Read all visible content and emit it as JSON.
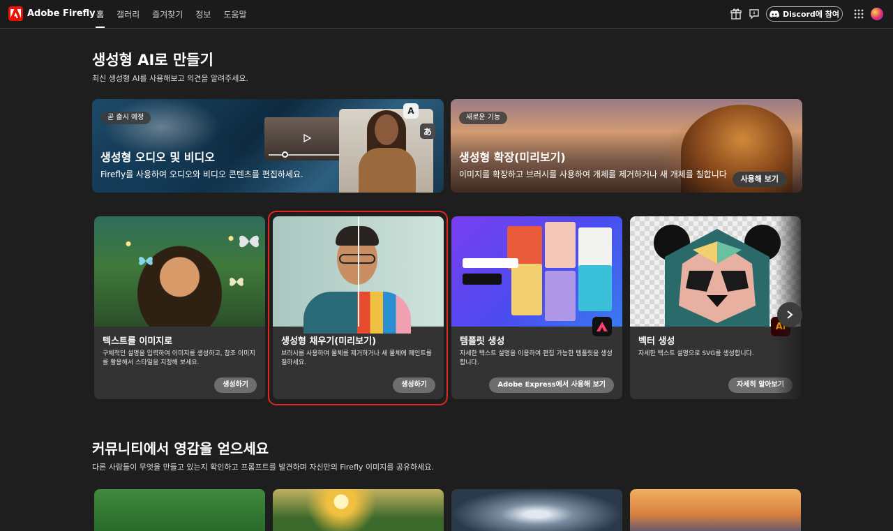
{
  "header": {
    "brand": "Adobe Firefly",
    "nav": [
      "홈",
      "갤러리",
      "즐겨찾기",
      "정보",
      "도움말"
    ],
    "discord_label": "Discord에 참여"
  },
  "hero": {
    "title": "생성형 AI로 만들기",
    "subtitle": "최신 생성형 AI를 사용해보고 의견을 알려주세요."
  },
  "banners": [
    {
      "pill": "곧 출시 예정",
      "title": "생성형 오디오 및 비디오",
      "desc": "Firefly를 사용하여 오디오와 비디오 콘텐츠를 편집하세요.",
      "chips": [
        "A",
        "あ"
      ]
    },
    {
      "pill": "새로운 기능",
      "title": "생성형 확장(미리보기)",
      "desc": "이미지를 확장하고 브러시를 사용하여 개체를 제거하거나 새 개체를 칠합니다",
      "button": "사용해 보기"
    }
  ],
  "cards": [
    {
      "title": "텍스트를 이미지로",
      "desc": "구체적인 설명을 입력하여 이미지를 생성하고, 참조 이미지를 활용해서 스타일을 지정해 보세요.",
      "button": "생성하기"
    },
    {
      "title": "생성형 채우기(미리보기)",
      "desc": "브러시를 사용하여 물체를 제거하거나 새 물체에 페인트를 칠하세요.",
      "button": "생성하기"
    },
    {
      "title": "템플릿 생성",
      "desc": "자세한 텍스트 설명을 이용하여 편집 가능한 템플릿을 생성합니다.",
      "button": "Adobe Express에서 사용해 보기"
    },
    {
      "title": "벡터 생성",
      "desc": "자세한 텍스트 설명으로 SVG를 생성합니다.",
      "button": "자세히 알아보기"
    }
  ],
  "community": {
    "title": "커뮤니티에서 영감을 얻으세요",
    "subtitle": "다른 사람들이 무엇을 만들고 있는지 확인하고 프롬프트를 발견하며 자신만의 Firefly 이미지를 공유하세요."
  },
  "colors": {
    "accent": "#eb1000",
    "highlight": "#e0281e",
    "background": "#1e1e1e"
  }
}
